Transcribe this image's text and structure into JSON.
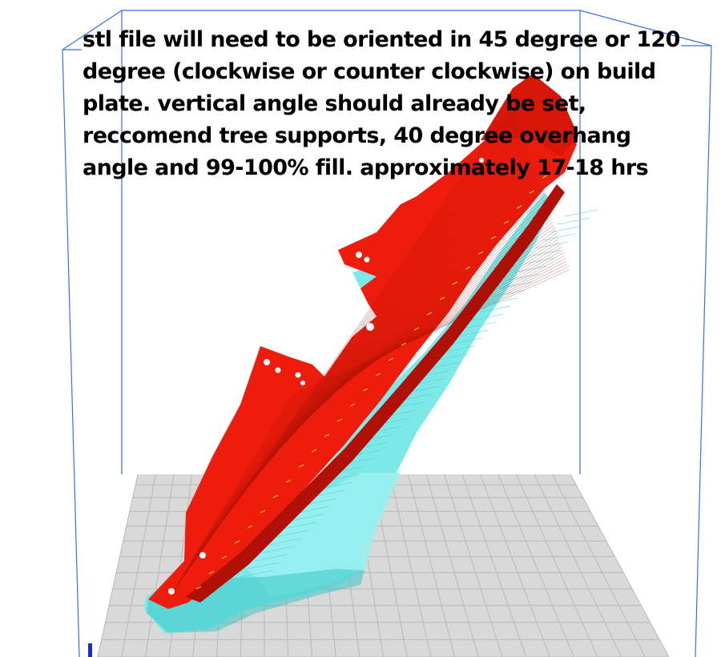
{
  "annotation": {
    "text": "stl file will need to be oriented in 45 degree or 120 degree (clockwise or counter clockwise) on build plate. vertical angle should already be set, reccomend tree supports, 40 degree overhang angle and 99-100% fill. approximately 17-18 hrs"
  },
  "viewport": {
    "colors": {
      "build_volume_edges": "#3a6fe0",
      "build_plate": "#d9d9d9",
      "build_plate_grid": "#b8b8b8",
      "model": "#ee1c0c",
      "model_dark": "#b01005",
      "support": "#7de8e8",
      "support_dark": "#3fc4c4",
      "infill_accent": "#c8c828",
      "axis_marker": "#1a2bd6"
    },
    "icons": [
      "build-volume",
      "build-plate",
      "sliced-model",
      "tree-supports",
      "z-axis-marker"
    ]
  }
}
